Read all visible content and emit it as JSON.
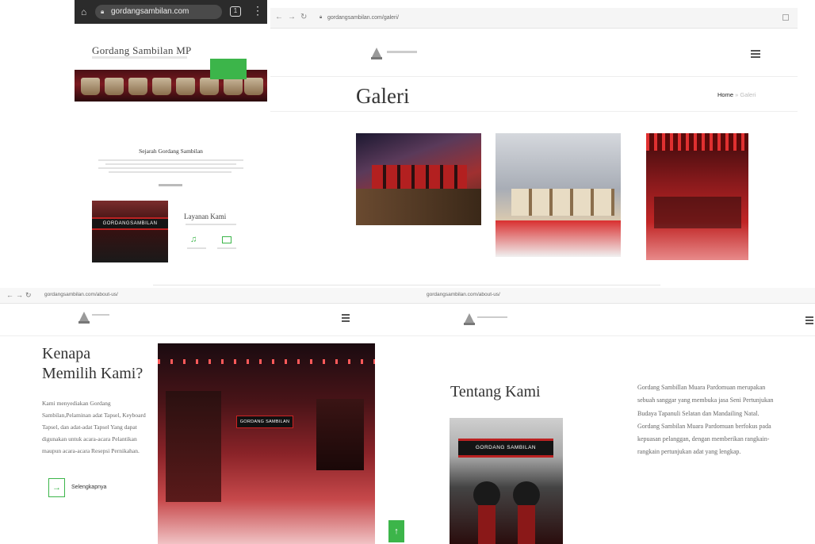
{
  "mobile": {
    "url": "gordangsambilan.com",
    "site_title": "Gordang Sambilan MP",
    "section_title": "Sejarah Gordang Sambilan",
    "services_title": "Layanan Kami",
    "thumb_banner_text": "GORDANGSAMBILAN"
  },
  "galeri": {
    "url": "gordangsambilan.com/galeri/",
    "page_title": "Galeri",
    "breadcrumb_home": "Home",
    "breadcrumb_sep": " » ",
    "breadcrumb_current": "Galeri"
  },
  "kenapa": {
    "url": "gordangsambilan.com/about-us/",
    "heading": "Kenapa Memilih Kami?",
    "paragraph": "Kami menyediakan Gordang Sambilan,Pelaminan adat Tapsel, Keyboard Tapsel, dan adat-adat Tapsel Yang dapat digunakan untuk acara-acara Pelantikan maupun acara-acara Resepsi Pernikahan.",
    "more_label": "Selengkapnya",
    "banner_text": "GORDANG SAMBILAN"
  },
  "tentang": {
    "url": "gordangsambilan.com/about-us/",
    "heading": "Tentang Kami",
    "paragraph": "Gordang Sambillan Muara Pardomuan merupakan sebuah sanggar yang membuka jasa Seni Pertunjukan Budaya Tapanuli Selatan dan Mandailing Natal. Gordang Sambilan Muara Pardomuan berfokus pada kepuasan pelanggan, dengan memberikan rangkain-rangkain pertunjukan adat yang lengkap.",
    "banner_text": "GORDANG SAMBILAN"
  },
  "colors": {
    "accent_green": "#3cb54a",
    "dark_red": "#7b1a20"
  }
}
